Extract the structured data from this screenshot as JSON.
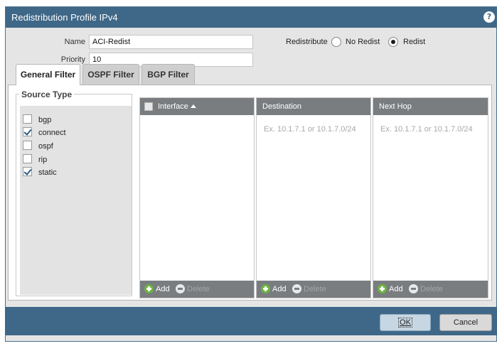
{
  "dialog": {
    "title": "Redistribution Profile IPv4",
    "help_icon": "?"
  },
  "form": {
    "name_label": "Name",
    "name_value": "ACI-Redist",
    "priority_label": "Priority",
    "priority_value": "10",
    "redistribute_label": "Redistribute",
    "options": [
      {
        "label": "No Redist",
        "selected": false
      },
      {
        "label": "Redist",
        "selected": true
      }
    ]
  },
  "tabs": [
    {
      "label": "General Filter",
      "active": true
    },
    {
      "label": "OSPF Filter",
      "active": false
    },
    {
      "label": "BGP Filter",
      "active": false
    }
  ],
  "source_type": {
    "legend": "Source Type",
    "items": [
      {
        "label": "bgp",
        "checked": false
      },
      {
        "label": "connect",
        "checked": true
      },
      {
        "label": "ospf",
        "checked": false
      },
      {
        "label": "rip",
        "checked": false
      },
      {
        "label": "static",
        "checked": true
      }
    ]
  },
  "grids": {
    "interface": {
      "header": "Interface",
      "add_label": "Add",
      "delete_label": "Delete"
    },
    "destination": {
      "header": "Destination",
      "placeholder": "Ex. 10.1.7.1 or 10.1.7.0/24",
      "add_label": "Add",
      "delete_label": "Delete"
    },
    "next_hop": {
      "header": "Next Hop",
      "placeholder": "Ex. 10.1.7.1 or 10.1.7.0/24",
      "add_label": "Add",
      "delete_label": "Delete"
    }
  },
  "buttons": {
    "ok_label": "OK",
    "cancel_label": "Cancel"
  },
  "colors": {
    "titlebar": "#3f6787",
    "grid_header": "#7a7d80",
    "add_green": "#6cb33f"
  }
}
